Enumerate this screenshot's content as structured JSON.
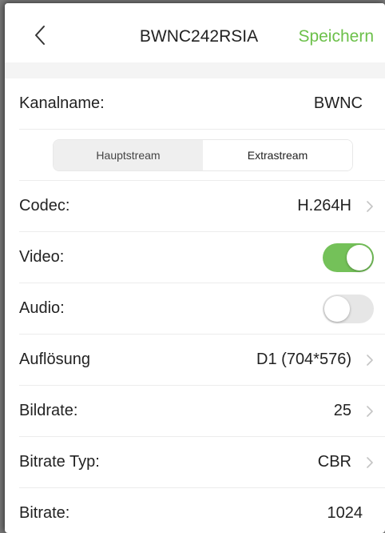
{
  "header": {
    "title": "BWNC242RSIA",
    "save_label": "Speichern",
    "back_icon": "chevron-left-icon"
  },
  "channel": {
    "label": "Kanalname:",
    "value": "BWNC"
  },
  "stream_tabs": {
    "main": "Hauptstream",
    "extra": "Extrastream",
    "selected": "Extrastream"
  },
  "settings": {
    "codec": {
      "label": "Codec:",
      "value": "H.264H"
    },
    "video": {
      "label": "Video:",
      "enabled": true
    },
    "audio": {
      "label": "Audio:",
      "enabled": false
    },
    "resolution": {
      "label": "Auflösung",
      "value": "D1 (704*576)"
    },
    "framerate": {
      "label": "Bildrate:",
      "value": "25"
    },
    "bitrate_type": {
      "label": "Bitrate Typ:",
      "value": "CBR"
    },
    "bitrate": {
      "label": "Bitrate:",
      "value": "1024"
    }
  },
  "colors": {
    "accent": "#6cc04a",
    "toggle_on": "#74c159",
    "toggle_off": "#e6e6e6"
  }
}
